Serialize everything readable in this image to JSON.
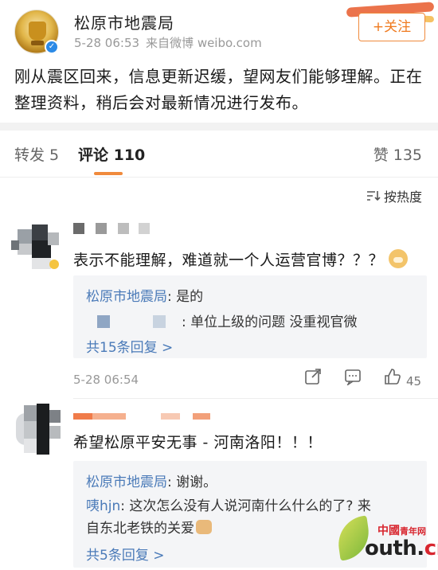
{
  "post": {
    "account_name": "松原市地震局",
    "timestamp": "5-28 06:53",
    "source": "来自微博 weibo.com",
    "follow_label": "+关注",
    "verified_mark": "✓",
    "text": "刚从震区回来，信息更新迟缓，望网友们能够理解。正在整理资料，稍后会对最新情况进行发布。"
  },
  "tabs": {
    "repost": "转发 5",
    "comments": "评论 110",
    "likes": "赞 135",
    "accent_color": "#f08a3c"
  },
  "sort": {
    "icon": "sort-lines-icon",
    "label": "按热度"
  },
  "comments": [
    {
      "text": "表示不能理解，难道就一个人运营官博？？？",
      "emoji": "doge-emoji",
      "replies": [
        {
          "name": "松原市地震局",
          "text": ": 是的"
        },
        {
          "name": "",
          "text": ": 单位上级的问题 没重视官微"
        }
      ],
      "more": "共15条回复 >",
      "time": "5-28 06:54",
      "like_count": "45"
    },
    {
      "text": "希望松原平安无事 - 河南洛阳！！！",
      "replies": [
        {
          "name": "松原市地震局",
          "text": ": 谢谢。"
        },
        {
          "name": "咦hjn",
          "text": ": 这次怎么没有人说河南什么什么的了? 来"
        },
        {
          "name": "",
          "text": "自东北老铁的关爱"
        }
      ],
      "more": "共5条回复 >"
    }
  ],
  "watermark": {
    "brand": "中國",
    "brand2": "青年网",
    "url_main": "outh.",
    "url_cn": "cn"
  },
  "colors": {
    "link_blue": "#4a7ab8",
    "watermark_red": "#d8262f",
    "verified_blue": "#2b8ae6"
  }
}
